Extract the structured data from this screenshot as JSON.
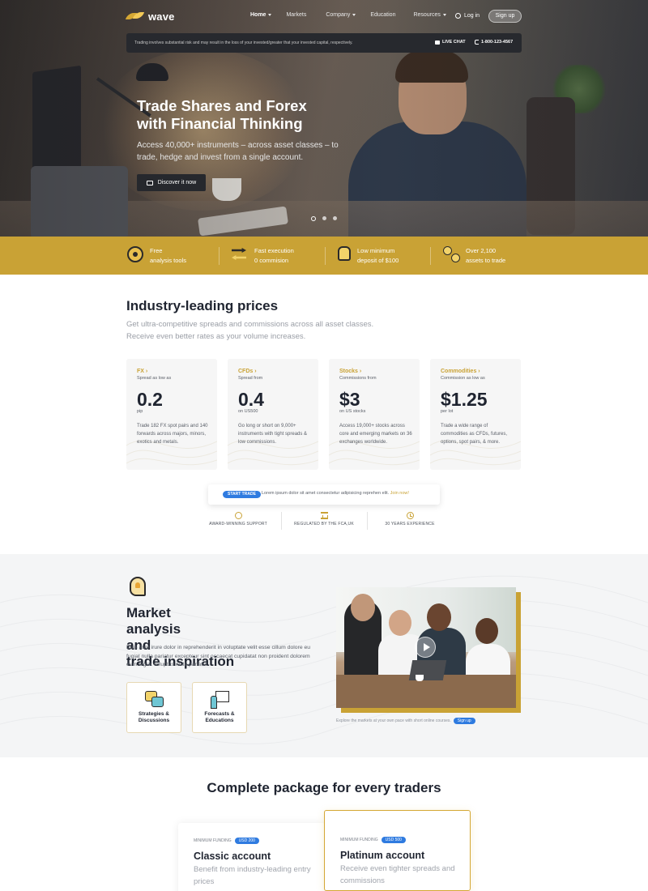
{
  "brand": {
    "name": "wave"
  },
  "nav": {
    "items": [
      {
        "label": "Home",
        "has_caret": true,
        "active": true
      },
      {
        "label": "Markets",
        "has_caret": false,
        "active": false
      },
      {
        "label": "Company",
        "has_caret": true,
        "active": false
      },
      {
        "label": "Education",
        "has_caret": false,
        "active": false
      },
      {
        "label": "Resources",
        "has_caret": true,
        "active": false
      }
    ],
    "login_label": "Log in",
    "signup_label": "Sign up"
  },
  "risk_bar": {
    "text": "Trading involves substantial risk and may result in the loss of your invested/greater that your invested capital, respectively.",
    "live_chat": "LIVE CHAT",
    "phone": "1-800-123-4567"
  },
  "hero": {
    "title_line1": "Trade Shares and Forex",
    "title_line2": "with Financial Thinking",
    "subtitle": "Access 40,000+ instruments – across asset classes – to trade, hedge and invest from a single account.",
    "cta": "Discover it now",
    "slides": 3,
    "active_slide": 1
  },
  "features": [
    {
      "icon": "target-icon",
      "line1": "Free",
      "line2": "analysis tools"
    },
    {
      "icon": "arrows-exchange-icon",
      "line1": "Fast execution",
      "line2": "0 commision"
    },
    {
      "icon": "hand-coin-icon",
      "line1": "Low minimum",
      "line2": "deposit of $100"
    },
    {
      "icon": "coins-icon",
      "line1": "Over 2,100",
      "line2": "assets to trade"
    }
  ],
  "prices": {
    "title_pre": "Industry-",
    "title_highlight": "leading",
    "title_post": " prices",
    "subtitle": "Get ultra-competitive spreads and commissions across all asset classes. Receive even better rates as your volume increases.",
    "cards": [
      {
        "category": "FX ›",
        "desc": "Spread as low as",
        "value": "0.2",
        "unit": "pip",
        "body": "Trade 182 FX spot pairs and 140 forwards across majors, minors, exotics and metals."
      },
      {
        "category": "CFDs ›",
        "desc": "Spread from",
        "value": "0.4",
        "unit": "on US500",
        "body": "Go long or short on 9,000+ instruments with tight spreads & low commissions."
      },
      {
        "category": "Stocks ›",
        "desc": "Commissions from",
        "value": "$3",
        "unit": "on US stocks",
        "body": "Access 19,000+ stocks across core and emerging markets on 36 exchanges worldwide."
      },
      {
        "category": "Commodities ›",
        "desc": "Commission as low as",
        "value": "$1.25",
        "unit": "per lot",
        "body": "Trade a wide range of commodities as CFDs, futures, options, spot pairs, & more."
      }
    ],
    "start": {
      "pill": "START TRADE",
      "text": "Lorem ipsum dolor sit amet consectetur adipisicing reprehen elit.",
      "link": "Join now!"
    },
    "trust": [
      {
        "icon": "award-icon",
        "label": "AWARD-WINNING SUPPORT"
      },
      {
        "icon": "bank-icon",
        "label": "REGULATED BY THE FCA,UK"
      },
      {
        "icon": "history-icon",
        "label": "30 YEARS EXPERIENCE"
      }
    ]
  },
  "analysis": {
    "title_line1_pre": "Market ",
    "title_line1_highlight": "analysis",
    "title_line1_post": " and",
    "title_line2": "trade inspiration",
    "body": "Duis aute irure dolor in reprehenderit in voluptate velit esse cillum dolore eu fugiat nulla pariatur excepteur sint occaecat cupidatat non proident dolorem eum fugiat voluptas nulla pariatur.",
    "cards": [
      {
        "icon": "chat-bubbles-icon",
        "label_line1": "Strategies &",
        "label_line2": "Discussions"
      },
      {
        "icon": "presentation-board-icon",
        "label_line1": "Forecasts &",
        "label_line2": "Educations"
      }
    ],
    "video_caption": "Explore the markets at your own pace with short online courses.",
    "video_signup": "Sign up"
  },
  "packages": {
    "title_highlight": "Complete",
    "title_post": " package for every traders",
    "cards": [
      {
        "min_label": "MINIMUM FUNDING",
        "min_value": "USD 200",
        "name": "Classic account",
        "desc": "Benefit from industry-leading entry prices"
      },
      {
        "min_label": "MINIMUM FUNDING",
        "min_value": "USD 500",
        "name": "Platinum account",
        "desc": "Receive even tighter spreads and commissions"
      }
    ]
  },
  "colors": {
    "gold": "#c9a235",
    "dark": "#1f2430",
    "blue_pill": "#2f7be0",
    "muted": "#9a9ea6"
  }
}
